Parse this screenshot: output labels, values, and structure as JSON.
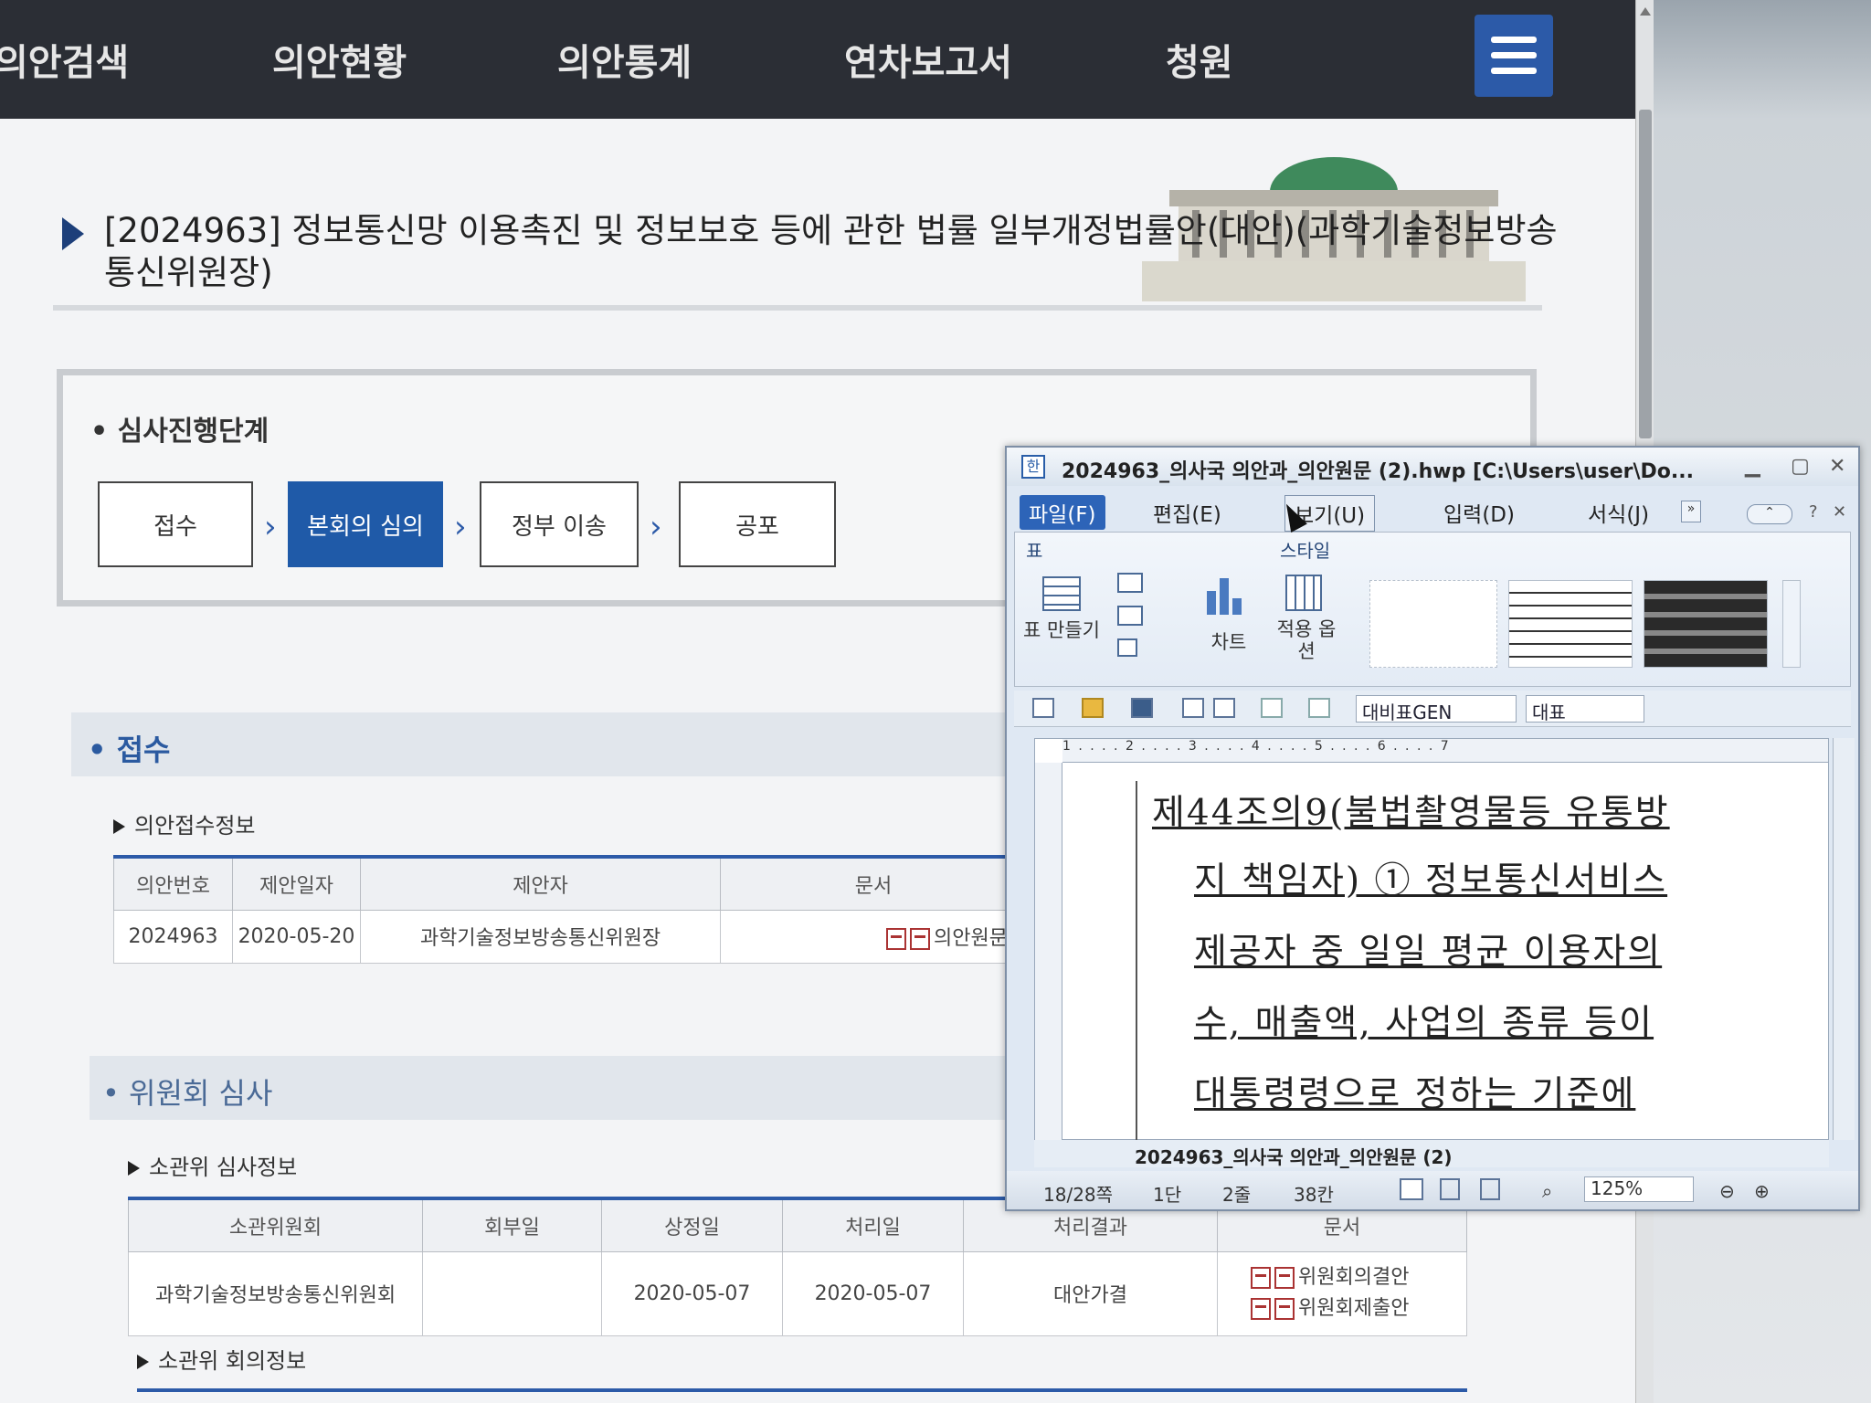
{
  "nav": {
    "items": [
      "의안검색",
      "의안현황",
      "의안통계",
      "연차보고서",
      "청원"
    ]
  },
  "title": {
    "text": "[2024963] 정보통신망 이용촉진 및 정보보호 등에 관한 법률 일부개정법률안(대안)(과학기술정보방송통신위원장)"
  },
  "stage": {
    "heading": "심사진행단계",
    "steps": [
      "접수",
      "본회의 심의",
      "정부 이송",
      "공포"
    ],
    "active_index": 1
  },
  "receipt": {
    "heading": "접수",
    "subheading": "의안접수정보",
    "columns": [
      "의안번호",
      "제안일자",
      "제안자",
      "문서"
    ],
    "row": {
      "bill_no": "2024963",
      "date": "2020-05-20",
      "proposer": "과학기술정보방송통신위원장",
      "doc": "의안원문"
    }
  },
  "committee": {
    "heading": "위원회 심사",
    "subheading": "소관위 심사정보",
    "columns": [
      "소관위원회",
      "회부일",
      "상정일",
      "처리일",
      "처리결과",
      "문서"
    ],
    "row": {
      "committee": "과학기술정보방송통신위원회",
      "referral": "",
      "presented": "2020-05-07",
      "processed": "2020-05-07",
      "result": "대안가결",
      "docs": [
        "위원회의결안",
        "위원회제출안"
      ]
    },
    "meeting_subheading": "소관위 회의정보"
  },
  "hwp": {
    "title": "2024963_의사국 의안과_의안원문 (2).hwp [C:\\Users\\user\\Do...",
    "menus": [
      "파일(F)",
      "편집(E)",
      "보기(U)",
      "입력(D)",
      "서식(J)"
    ],
    "ribbon": {
      "group_table": "표",
      "group_style": "스타일",
      "make_table": "표 만들기",
      "chart": "차트",
      "apply_option": "적용 옵션"
    },
    "toolbar": {
      "style_combo": "대비표GEN",
      "font_combo": "대표"
    },
    "doc_lines": [
      "제44조의9(불법촬영물등 유통방",
      "지 책임자) ① 정보통신서비스",
      "제공자 중 일일 평균 이용자의",
      "수, 매출액, 사업의 종류 등이",
      "대통령령으로 정하는 기준에"
    ],
    "ruler_text": "1 . . . . 2 . . . . 3 . . . . 4 . . . . 5 . . . . 6 . . . . 7",
    "doc_tab": "2024963_의사국 의안과_의안원문 (2)",
    "status": {
      "page": "18/28쪽",
      "section": "1단",
      "line": "2줄",
      "col": "38칸",
      "zoom": "125%"
    }
  },
  "colors": {
    "nav_bg": "#2b2e35",
    "accent": "#1f5aa8",
    "section_text": "#2b5aa0"
  }
}
